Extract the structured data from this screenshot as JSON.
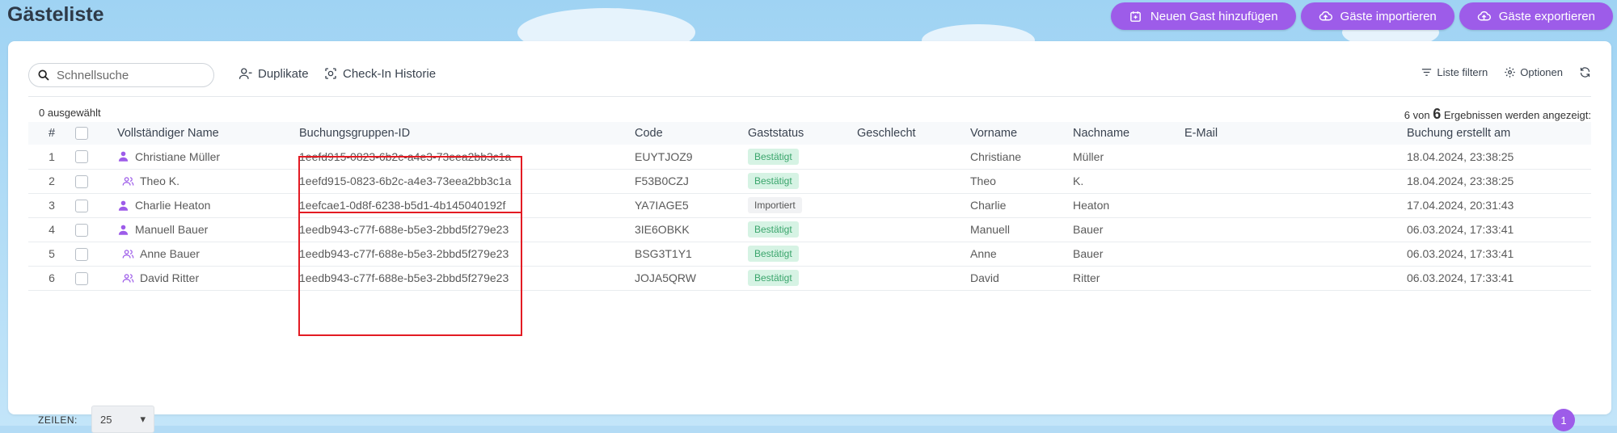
{
  "page": {
    "title": "Gästeliste"
  },
  "actions": {
    "add_guest": "Neuen Gast hinzufügen",
    "import": "Gäste importieren",
    "export": "Gäste exportieren"
  },
  "toolbar": {
    "search_placeholder": "Schnellsuche",
    "duplicates": "Duplikate",
    "checkin_history": "Check-In Historie",
    "filter": "Liste filtern",
    "options": "Optionen"
  },
  "selection": {
    "count_text": "0 ausgewählt"
  },
  "results": {
    "prefix": "6 von",
    "total": "6",
    "suffix": "Ergebnissen werden angezeigt:"
  },
  "table": {
    "headers": {
      "num": "#",
      "name": "Vollständiger Name",
      "group_id": "Buchungsgruppen-ID",
      "code": "Code",
      "status": "Gaststatus",
      "gender": "Geschlecht",
      "first": "Vorname",
      "last": "Nachname",
      "email": "E-Mail",
      "created": "Buchung erstellt am"
    },
    "rows": [
      {
        "num": "1",
        "name": "Christiane Müller",
        "group_id": "1eefd915-0823-6b2c-a4e3-73eea2bb3c1a",
        "code": "EUYTJOZ9",
        "status": "Bestätigt",
        "gender": "",
        "first": "Christiane",
        "last": "Müller",
        "email": "",
        "created": "18.04.2024, 23:38:25"
      },
      {
        "num": "2",
        "name": "Theo K.",
        "group_id": "1eefd915-0823-6b2c-a4e3-73eea2bb3c1a",
        "code": "F53B0CZJ",
        "status": "Bestätigt",
        "gender": "",
        "first": "Theo",
        "last": "K.",
        "email": "",
        "created": "18.04.2024, 23:38:25"
      },
      {
        "num": "3",
        "name": "Charlie Heaton",
        "group_id": "1eefcae1-0d8f-6238-b5d1-4b145040192f",
        "code": "YA7IAGE5",
        "status": "Importiert",
        "gender": "",
        "first": "Charlie",
        "last": "Heaton",
        "email": "",
        "created": "17.04.2024, 20:31:43"
      },
      {
        "num": "4",
        "name": "Manuell Bauer",
        "group_id": "1eedb943-c77f-688e-b5e3-2bbd5f279e23",
        "code": "3IE6OBKK",
        "status": "Bestätigt",
        "gender": "",
        "first": "Manuell",
        "last": "Bauer",
        "email": "",
        "created": "06.03.2024, 17:33:41"
      },
      {
        "num": "5",
        "name": "Anne Bauer",
        "group_id": "1eedb943-c77f-688e-b5e3-2bbd5f279e23",
        "code": "BSG3T1Y1",
        "status": "Bestätigt",
        "gender": "",
        "first": "Anne",
        "last": "Bauer",
        "email": "",
        "created": "06.03.2024, 17:33:41"
      },
      {
        "num": "6",
        "name": "David Ritter",
        "group_id": "1eedb943-c77f-688e-b5e3-2bbd5f279e23",
        "code": "JOJA5QRW",
        "status": "Bestätigt",
        "gender": "",
        "first": "David",
        "last": "Ritter",
        "email": "",
        "created": "06.03.2024, 17:33:41"
      }
    ]
  },
  "footer": {
    "rows_label": "ZEILEN:",
    "rows_value": "25",
    "page": "1"
  },
  "colors": {
    "accent": "#9d5ce9",
    "highlight": "#e31b23",
    "status_ok_bg": "#d6f3e4",
    "status_ok_fg": "#3aa56c"
  },
  "icons": {
    "add": "calendar-plus-icon",
    "import": "cloud-upload-icon",
    "export": "cloud-upload-icon",
    "search": "search-icon",
    "duplicates": "user-minus-icon",
    "checkin": "scan-icon",
    "filter": "filter-list-icon",
    "options": "gear-icon",
    "refresh": "refresh-icon",
    "main_guest": "user-icon",
    "companion": "users-icon"
  }
}
